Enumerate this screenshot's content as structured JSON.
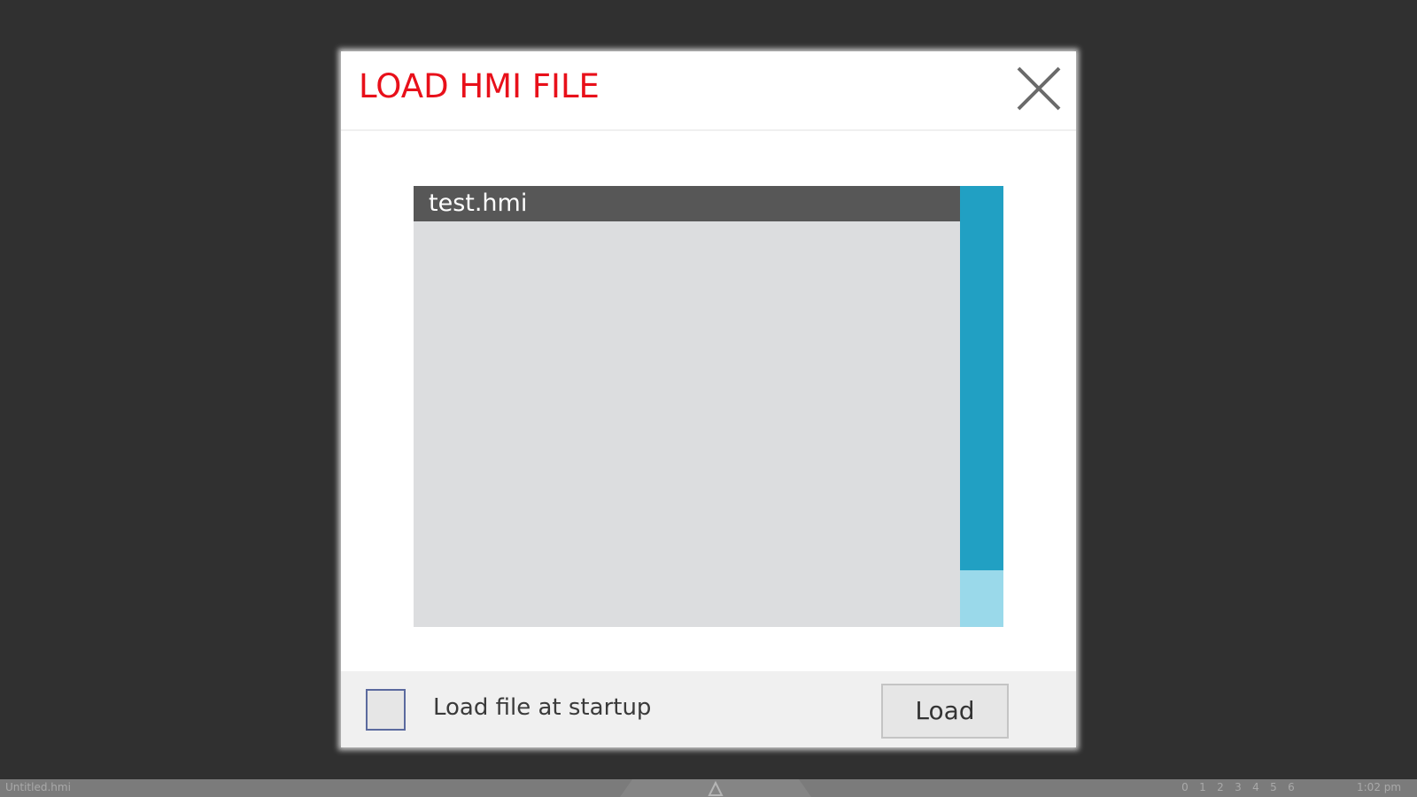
{
  "dialog": {
    "title": "LOAD HMI FILE",
    "title_color": "#e8101a",
    "close_icon": "close-icon"
  },
  "file_list": {
    "items": [
      {
        "name": "test.hmi",
        "selected": true
      }
    ],
    "selected_bg": "#575757",
    "list_bg": "#dcdddf",
    "scrollbar_track_color": "#9ad9ea",
    "scrollbar_thumb_color": "#21a0c3"
  },
  "footer": {
    "startup_checkbox_checked": false,
    "startup_label": "Load file at startup",
    "load_button": "Load"
  },
  "statusbar": {
    "file_name": "Untitled.hmi",
    "center_icon": "warning-icon",
    "pages": [
      "0",
      "1",
      "2",
      "3",
      "4",
      "5",
      "6"
    ],
    "time": "1:02 pm"
  }
}
